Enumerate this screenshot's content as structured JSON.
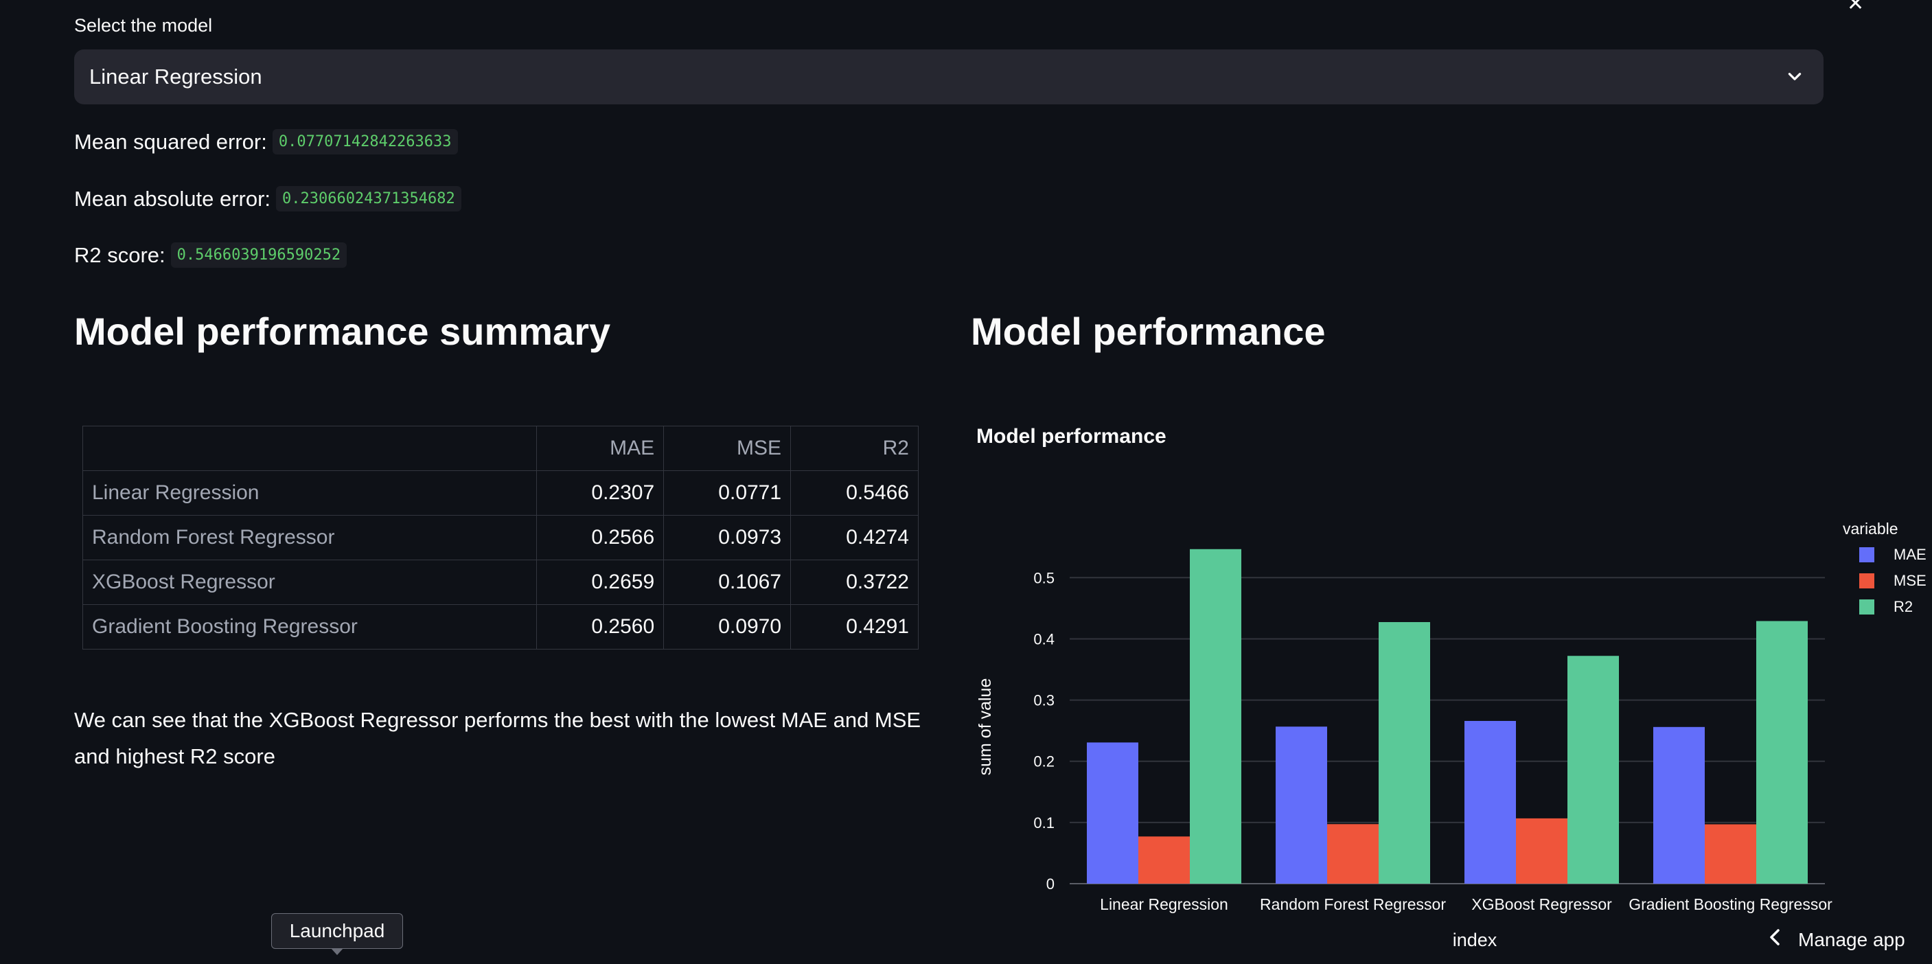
{
  "select": {
    "label": "Select the model",
    "value": "Linear Regression"
  },
  "metrics": {
    "mse_label": "Mean squared error:",
    "mse_value": "0.07707142842263633",
    "mae_label": "Mean absolute error:",
    "mae_value": "0.23066024371354682",
    "r2_label": "R2 score:",
    "r2_value": "0.5466039196590252"
  },
  "summary": {
    "heading": "Model performance summary",
    "columns": [
      "",
      "MAE",
      "MSE",
      "R2"
    ],
    "rows": [
      {
        "name": "Linear Regression",
        "mae": "0.2307",
        "mse": "0.0771",
        "r2": "0.5466"
      },
      {
        "name": "Random Forest Regressor",
        "mae": "0.2566",
        "mse": "0.0973",
        "r2": "0.4274"
      },
      {
        "name": "XGBoost Regressor",
        "mae": "0.2659",
        "mse": "0.1067",
        "r2": "0.3722"
      },
      {
        "name": "Gradient Boosting Regressor",
        "mae": "0.2560",
        "mse": "0.0970",
        "r2": "0.4291"
      }
    ],
    "paragraph": "We can see that the XGBoost Regressor performs the best with the lowest MAE and MSE and highest R2 score"
  },
  "chart_section": {
    "heading": "Model performance"
  },
  "chart_data": {
    "type": "bar",
    "title": "Model performance",
    "xlabel": "index",
    "ylabel": "sum of value",
    "categories": [
      "Linear Regression",
      "Random Forest Regressor",
      "XGBoost Regressor",
      "Gradient Boosting Regressor"
    ],
    "series": [
      {
        "name": "MAE",
        "color": "#636efa",
        "values": [
          0.2307,
          0.2566,
          0.2659,
          0.256
        ]
      },
      {
        "name": "MSE",
        "color": "#ef553b",
        "values": [
          0.0771,
          0.0973,
          0.1067,
          0.097
        ]
      },
      {
        "name": "R2",
        "color": "#5ac998",
        "values": [
          0.5466,
          0.4274,
          0.3722,
          0.4291
        ]
      }
    ],
    "yticks": [
      0,
      0.1,
      0.2,
      0.3,
      0.4,
      0.5
    ],
    "ytick_labels": [
      "0",
      "0.1",
      "0.2",
      "0.3",
      "0.4",
      "0.5"
    ],
    "ylim": [
      0,
      0.58
    ],
    "legend_title": "variable",
    "legend_position": "right",
    "grid": true
  },
  "footer": {
    "launchpad": "Launchpad",
    "manage_app": "Manage app"
  }
}
